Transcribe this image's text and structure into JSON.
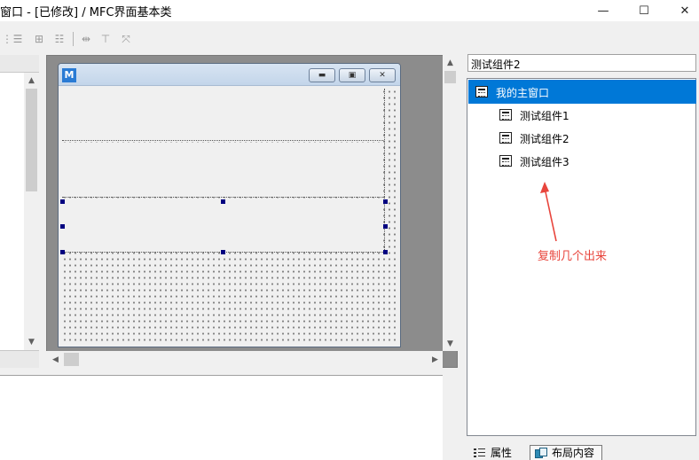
{
  "window": {
    "title": "窗口 - [已修改] / MFC界面基本类",
    "minimize_glyph": "—",
    "maximize_glyph": "☐",
    "close_glyph": "✕"
  },
  "toolbar": {
    "icons": [
      "align-icon",
      "list-icon",
      "grid-icon",
      "tree-icon",
      "distribute-icon",
      "text-height-icon",
      "resize-icon"
    ]
  },
  "form_preview": {
    "logo_letter": "M",
    "min_glyph": "▬",
    "max_glyph": "▣",
    "close_glyph": "✕"
  },
  "right_panel": {
    "selected_name": "测试组件2",
    "tree": {
      "root": "我的主窗口",
      "children": [
        "测试组件1",
        "测试组件2",
        "测试组件3"
      ]
    },
    "annotation": "复制几个出来",
    "tabs": {
      "properties": "属性",
      "layout": "布局内容"
    }
  },
  "colors": {
    "accent": "#0078d7",
    "annotation": "#e8453c",
    "handle": "#000080"
  }
}
